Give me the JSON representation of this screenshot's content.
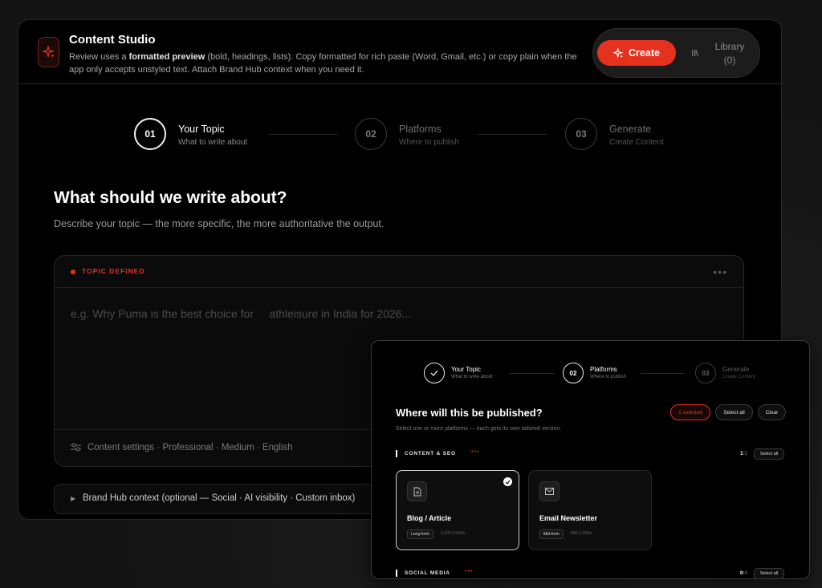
{
  "app": {
    "title": "Content Studio",
    "desc_pre": "Review uses a ",
    "desc_bold": "formatted preview",
    "desc_post": " (bold, headings, lists). Copy formatted for rich paste (Word, Gmail, etc.) or copy plain when the app only accepts unstyled text. Attach Brand Hub context when you need it.",
    "create_label": "Create",
    "library_label": "Library",
    "library_count": "(0)",
    "accent": "#e5321f"
  },
  "steps": [
    {
      "num": "01",
      "title": "Your Topic",
      "sub": "What to write about"
    },
    {
      "num": "02",
      "title": "Platforms",
      "sub": "Where to publish"
    },
    {
      "num": "03",
      "title": "Generate",
      "sub": "Create Content"
    }
  ],
  "topic": {
    "heading": "What should we write about?",
    "subheading": "Describe your topic — the more specific, the more authoritative the output.",
    "status_label": "TOPIC DEFINED",
    "menu": "•••",
    "placeholder": "e.g. Why Puma is the best choice for     athleisure in India for 2026...",
    "settings": "Content settings · Professional · Medium · English"
  },
  "brand_hub": {
    "arrow": "▶",
    "label": "Brand Hub context (optional — Social · AI visibility · Custom inbox)"
  },
  "overlay": {
    "steps": [
      {
        "num": "✓",
        "title": "Your Topic",
        "sub": "What to write about"
      },
      {
        "num": "02",
        "title": "Platforms",
        "sub": "Where to publish"
      },
      {
        "num": "03",
        "title": "Generate",
        "sub": "Create Content"
      }
    ],
    "heading": "Where will this be published?",
    "subheading": "Select one or more platforms — each gets its own tailored version.",
    "selected_pill": "1 selected",
    "select_all": "Select all",
    "clear": "Clear",
    "sections": [
      {
        "label": "CONTENT & SEO",
        "dots": "•••",
        "count_num": "1",
        "count_total": "/2",
        "btn": "Select all"
      },
      {
        "label": "SOCIAL MEDIA",
        "dots": "•••",
        "count_num": "0",
        "count_total": "/4",
        "btn": "Select all"
      }
    ],
    "cards": [
      {
        "name": "Blog / Article",
        "tag": "Long-form",
        "range": "1,500-2,500w",
        "selected": true,
        "icon": "document-icon"
      },
      {
        "name": "Email Newsletter",
        "tag": "Mid-form",
        "range": "600-1,000w",
        "selected": false,
        "icon": "mail-icon"
      }
    ]
  }
}
